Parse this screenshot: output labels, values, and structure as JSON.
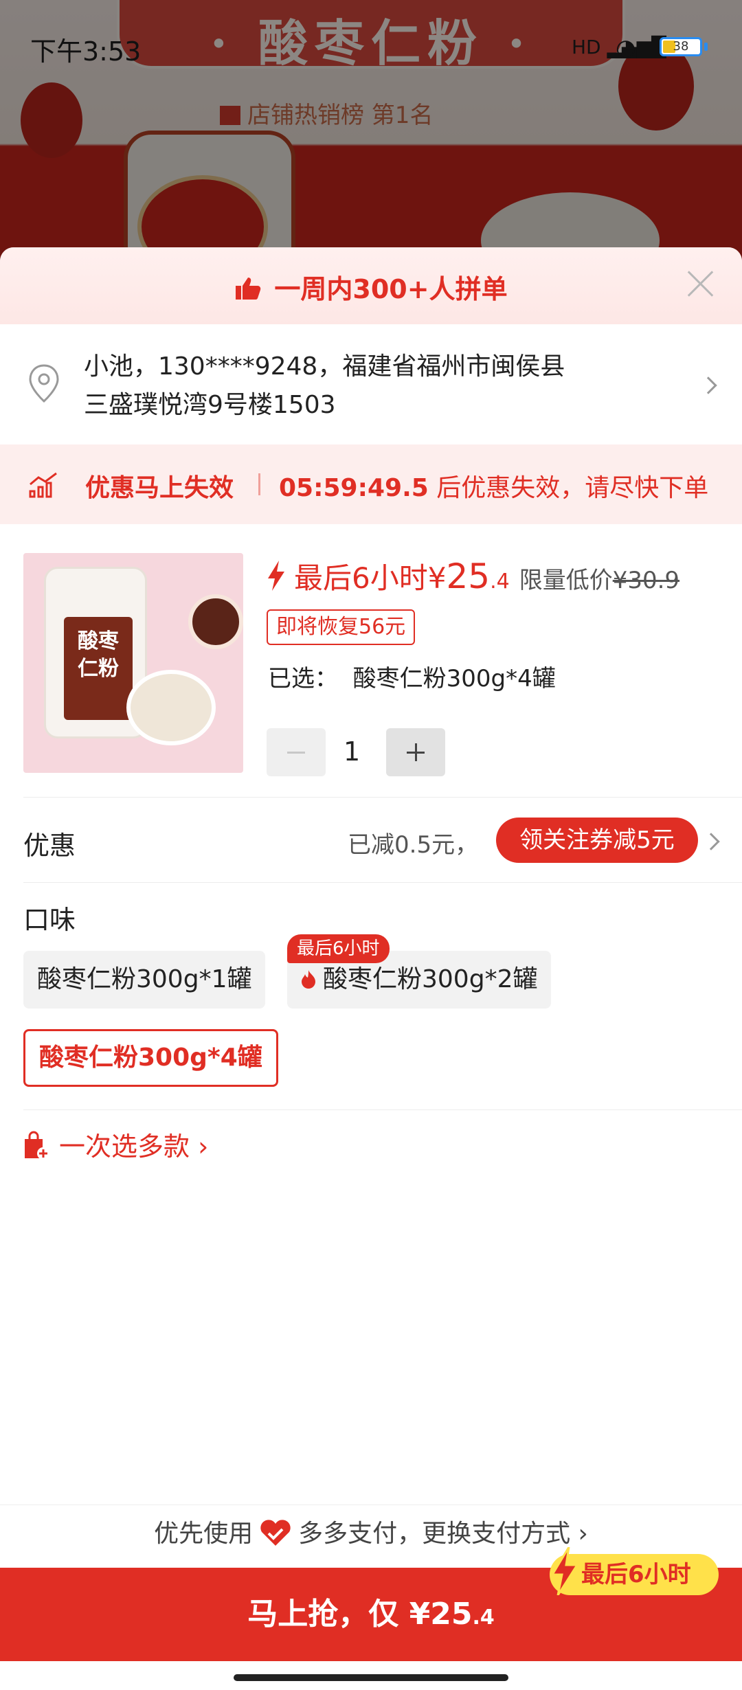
{
  "status_bar": {
    "time": "下午3:53",
    "signal": "HD",
    "battery": "38"
  },
  "background_page": {
    "banner_title": "· 酸枣仁粉 ·",
    "rank_text": "店铺热销榜 第1名"
  },
  "sheet": {
    "social_proof": "一周内300+人拼单",
    "address": {
      "line1": "小池，130****9248，福建省福州市闽侯县",
      "line2": "三盛璞悦湾9号楼1503"
    },
    "countdown": {
      "title": "优惠马上失效",
      "time": "05:59:49.5",
      "suffix": " 后优惠失效，请尽快下单"
    },
    "product": {
      "image_label": "酸枣仁粉",
      "price_prefix": "最后6小时",
      "currency": "¥",
      "price_int": "25",
      "price_dec": ".4",
      "limited_label": "限量低价",
      "original_price": "¥30.9",
      "restore_tag": "即将恢复56元",
      "selected_label": "已选：",
      "selected_value": "酸枣仁粉300g*4罐",
      "quantity": "1"
    },
    "promo": {
      "label": "优惠",
      "reduced_text": "已减0.5元，",
      "coupon_button": "领关注券减5元"
    },
    "flavor": {
      "label": "口味",
      "options": [
        {
          "label": "酸枣仁粉300g*1罐"
        },
        {
          "label": "酸枣仁粉300g*2罐",
          "badge": "最后6小时"
        },
        {
          "label": "酸枣仁粉300g*4罐"
        }
      ]
    },
    "multi_select": "一次选多款",
    "payment": {
      "prefix": "优先使用",
      "method": "多多支付，更换支付方式"
    },
    "buy_button": {
      "text": "马上抢，仅 ¥25",
      "decimal": ".4",
      "urgent_tag": "最后6小时"
    }
  },
  "colors": {
    "accent": "#e02e24",
    "urgent_tag_bg": "#ffe14a",
    "banner_bg": "#fdeeed"
  }
}
